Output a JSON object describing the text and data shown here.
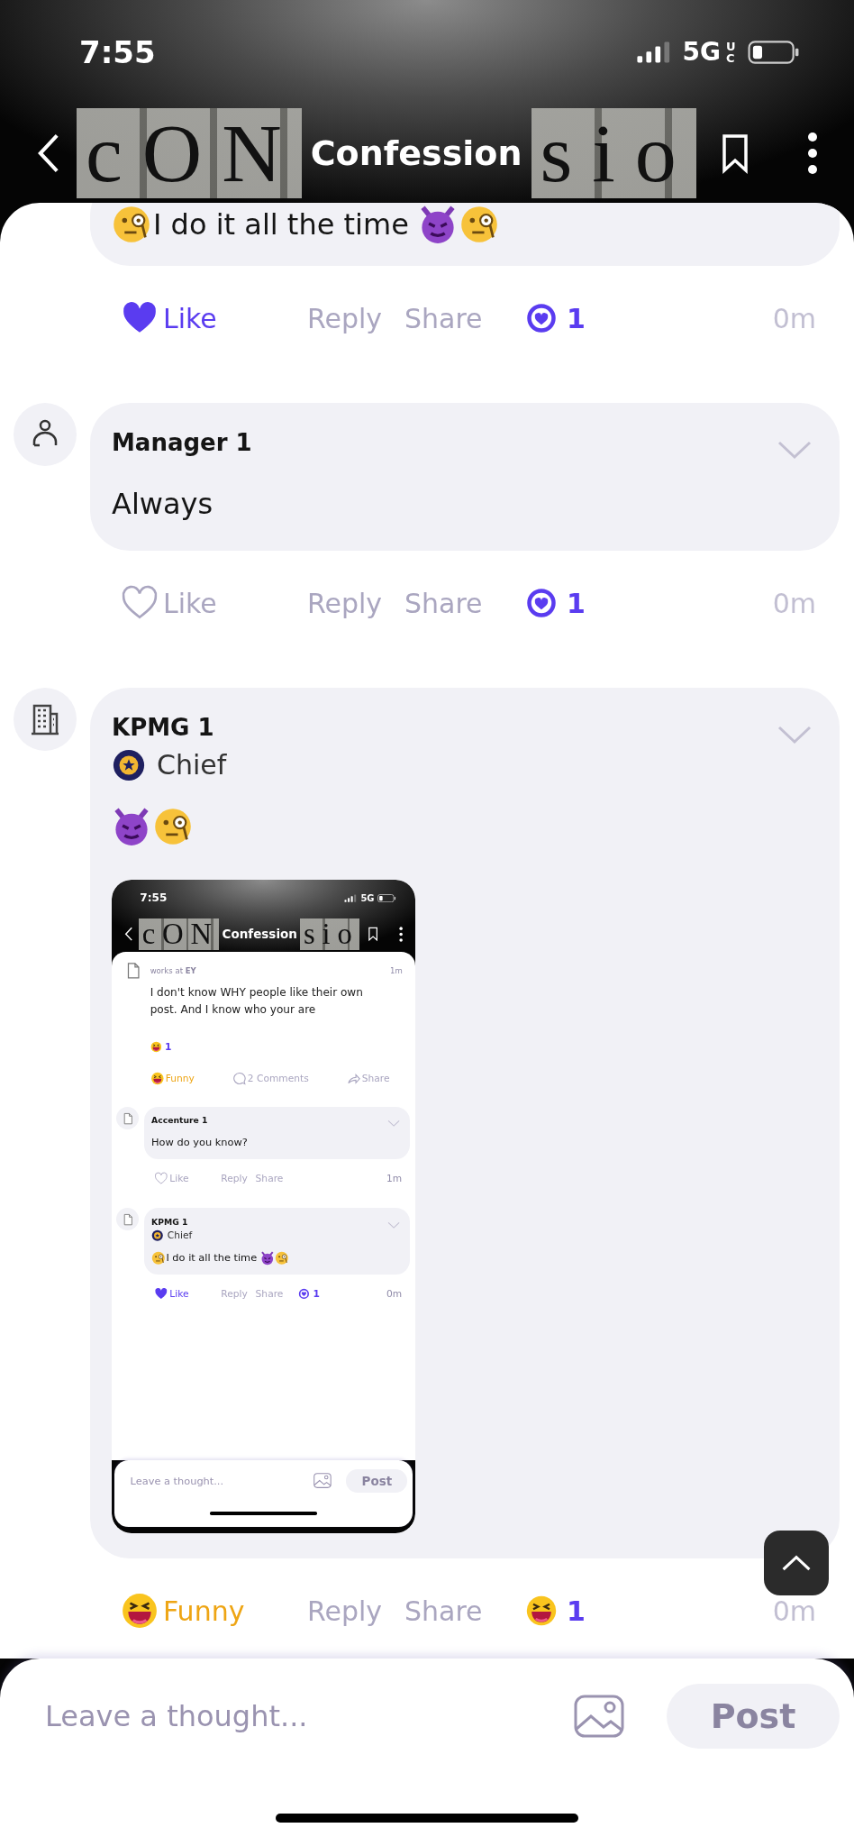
{
  "status_bar": {
    "time": "7:55",
    "network": "5G",
    "network_sub": "UC"
  },
  "header": {
    "title": "Confession",
    "lettering_left": "cON",
    "lettering_right": "sio"
  },
  "comments": [
    {
      "cut_off": true,
      "segments": [
        {
          "kind": "monocle-emoji"
        },
        {
          "kind": "text",
          "text": "I do it all the time "
        },
        {
          "kind": "devil-emoji"
        },
        {
          "kind": "monocle-emoji"
        }
      ],
      "reaction": {
        "kind": "like",
        "label": "Like",
        "selected": true
      },
      "reply": "Reply",
      "share": "Share",
      "count": {
        "kind": "heart",
        "value": "1"
      },
      "time": "0m"
    },
    {
      "avatar": {
        "kind": "person"
      },
      "author": "Manager 1",
      "segments": [
        {
          "kind": "text",
          "text": "Always"
        }
      ],
      "reaction": {
        "kind": "like",
        "label": "Like",
        "selected": false
      },
      "reply": "Reply",
      "share": "Share",
      "count": {
        "kind": "heart",
        "value": "1"
      },
      "time": "0m"
    },
    {
      "avatar": {
        "kind": "building"
      },
      "author": "KPMG 1",
      "badge": "Chief",
      "segments": [
        {
          "kind": "devil-emoji"
        },
        {
          "kind": "monocle-emoji"
        }
      ],
      "attachment": {
        "kind": "screenshot",
        "status_bar": {
          "time": "7:55",
          "network": "5G"
        },
        "header": {
          "title": "Confession",
          "lettering_left": "cON",
          "lettering_right": "sio"
        },
        "post": {
          "avatar": {
            "kind": "document"
          },
          "author": "works at **EY**",
          "time": "1m",
          "text": "I don't know WHY people like their own post. And I know who your are",
          "count": {
            "kind": "laugh",
            "value": "1"
          },
          "reaction": {
            "kind": "funny",
            "label": "Funny",
            "selected": true
          },
          "comments_label": "2 Comments",
          "share": "Share"
        },
        "comments": [
          {
            "avatar": {
              "kind": "document"
            },
            "author": "Accenture 1",
            "segments": [
              {
                "kind": "text",
                "text": "How do you know?"
              }
            ],
            "reaction": {
              "kind": "like",
              "label": "Like",
              "selected": false
            },
            "reply": "Reply",
            "share": "Share",
            "time": "1m"
          },
          {
            "avatar": {
              "kind": "document"
            },
            "author": "KPMG 1",
            "badge": "Chief",
            "segments": [
              {
                "kind": "monocle-emoji"
              },
              {
                "kind": "text",
                "text": "I do it all the time "
              },
              {
                "kind": "devil-emoji"
              },
              {
                "kind": "monocle-emoji"
              }
            ],
            "reaction": {
              "kind": "like",
              "label": "Like",
              "selected": true
            },
            "reply": "Reply",
            "share": "Share",
            "count": {
              "kind": "heart",
              "value": "1"
            },
            "time": "0m"
          }
        ],
        "composer": {
          "placeholder": "Leave a thought...",
          "button": "Post"
        }
      },
      "reaction": {
        "kind": "funny",
        "label": "Funny",
        "selected": true
      },
      "reply": "Reply",
      "share": "Share",
      "count": {
        "kind": "laugh",
        "value": "1"
      },
      "time": "0m"
    }
  ],
  "composer": {
    "placeholder": "Leave a thought...",
    "button": "Post"
  }
}
